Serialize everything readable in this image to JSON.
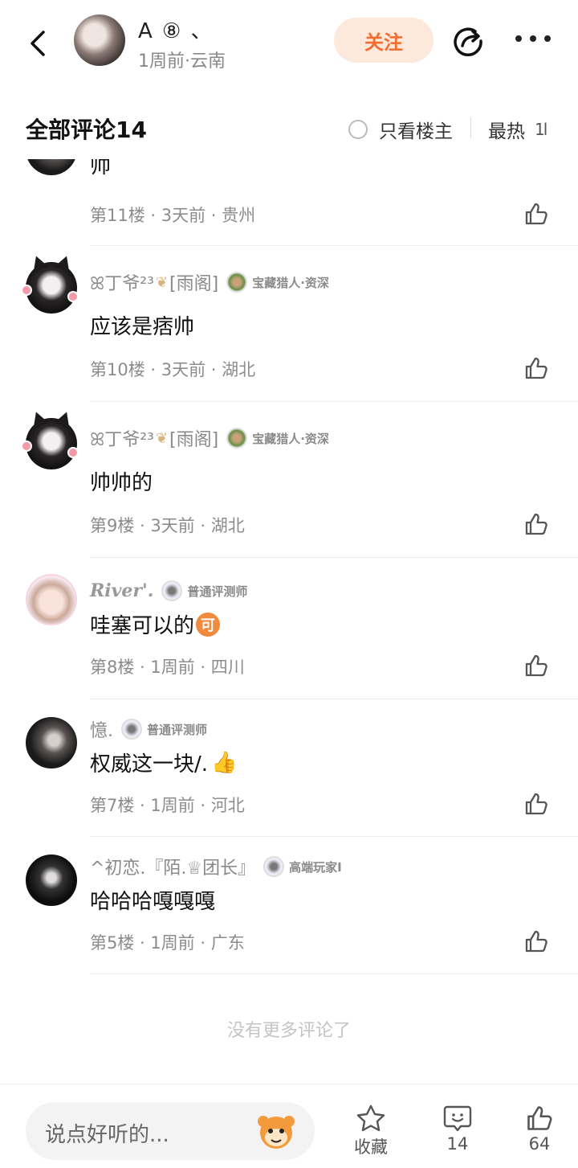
{
  "header": {
    "author_name": "A ⑧ 、",
    "author_meta": "1周前·云南",
    "follow_label": "关注"
  },
  "comments_header": {
    "title": "全部评论14",
    "only_owner_label": "只看楼主",
    "sort_label": "最热",
    "sort_icon": "1l"
  },
  "partial_comment": {
    "body": "帅",
    "meta": "第11楼 · 3天前 · 贵州"
  },
  "comments": [
    {
      "nick": "ꕤ丁爷²³",
      "nick_suffix": "[雨阁]",
      "badge": "宝藏猎人·资深",
      "body": "应该是痞帅",
      "meta": "第10楼 · 3天前 · 湖北"
    },
    {
      "nick": "ꕤ丁爷²³",
      "nick_suffix": "[雨阁]",
      "badge": "宝藏猎人·资深",
      "body": "帅帅的",
      "meta": "第9楼 · 3天前 · 湖北"
    },
    {
      "nick": "River'.",
      "badge": "普通评测师",
      "body": "哇塞可以的",
      "emoji": "可",
      "meta": "第8楼 · 1周前 · 四川"
    },
    {
      "nick": "憶.",
      "badge": "普通评测师",
      "body": "权威这一块/.",
      "emoji": "👍",
      "meta": "第7楼 · 1周前 · 河北"
    },
    {
      "nick": "^初恋.『陌.♕团长』",
      "badge": "高端玩家Ⅰ",
      "body": "哈哈哈嘎嘎嘎",
      "meta": "第5楼 · 1周前 · 广东"
    }
  ],
  "no_more_text": "没有更多评论了",
  "bottombar": {
    "input_placeholder": "说点好听的...",
    "collect_label": "收藏",
    "comment_count": "14",
    "like_count": "64"
  },
  "colors": {
    "accent": "#f36d2e",
    "follow_bg": "#fde8dc"
  }
}
